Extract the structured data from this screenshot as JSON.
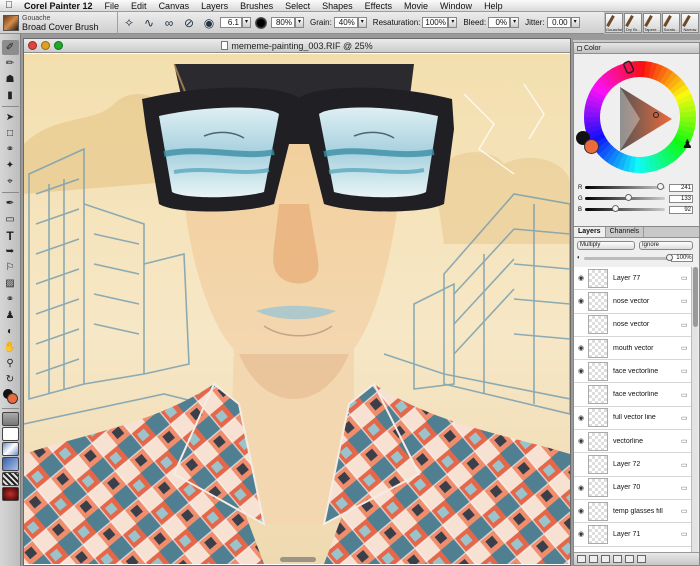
{
  "menubar": {
    "apple": "",
    "items": [
      "Corel Painter 12",
      "File",
      "Edit",
      "Canvas",
      "Layers",
      "Brushes",
      "Select",
      "Shapes",
      "Effects",
      "Movie",
      "Window",
      "Help"
    ]
  },
  "propbar": {
    "brush_category": "Gouache",
    "brush_variant": "Broad Cover Brush",
    "size_value": "6.1",
    "opacity_value": "80%",
    "grain_label": "Grain:",
    "grain_value": "40%",
    "resaturation_label": "Resaturation:",
    "resaturation_value": "100%",
    "bleed_label": "Bleed:",
    "bleed_value": "0%",
    "jitter_label": "Jitter:",
    "jitter_value": "0.00"
  },
  "brush_library": [
    "Gouache",
    "Dry Br...",
    "Tapere...",
    "Scrato...",
    "Narrow"
  ],
  "document": {
    "title": "mememe-painting_003.RIF @ 25%"
  },
  "color_panel": {
    "title": "Color",
    "main_color": "#ec6b3c",
    "additional_color": "#111111",
    "sliders": [
      {
        "label": "R",
        "value": "241",
        "level": 0.945
      },
      {
        "label": "G",
        "value": "133",
        "level": 0.52
      },
      {
        "label": "B",
        "value": "92",
        "level": 0.36
      }
    ]
  },
  "layers_panel": {
    "tabs": [
      "Layers",
      "Channels"
    ],
    "composite_method": "Multiply",
    "preserve": "Ignore",
    "opacity_value": "100%",
    "layers": [
      "Layer 77",
      "nose vector",
      "nose vector",
      "mouth vector",
      "face vectorline",
      "face vectorline",
      "full vector line",
      "vectorline",
      "Layer 72",
      "Layer 70",
      "temp glasses fill",
      "Layer 71"
    ]
  }
}
